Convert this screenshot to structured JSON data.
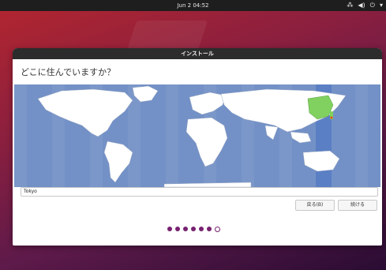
{
  "topbar": {
    "clock": "Jun 2  04:52"
  },
  "window": {
    "title": "インストール",
    "heading": "どこに住んでいますか？"
  },
  "timezone": {
    "value": "Tokyo"
  },
  "buttons": {
    "back_label": "戻る(B)",
    "next_label": "続ける"
  },
  "progress": {
    "total_steps": 7,
    "current_step": 7
  },
  "colors": {
    "accent": "#77216f",
    "map_ocean": "#7391c6",
    "selected_region": "#80d15f"
  },
  "icons": [
    "network-icon",
    "volume-icon",
    "power-icon",
    "menu-arrow-icon"
  ]
}
